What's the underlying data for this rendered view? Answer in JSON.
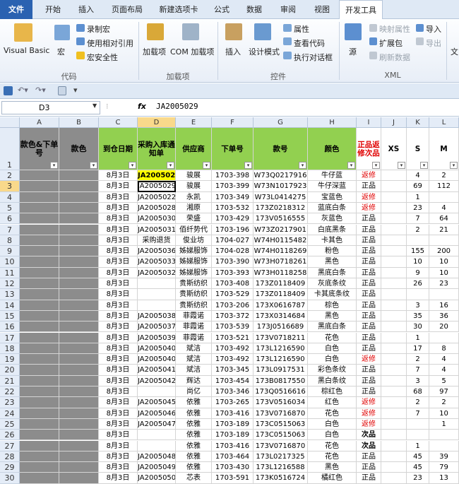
{
  "tabs": {
    "file": "文件",
    "home": "开始",
    "insert": "插入",
    "layout": "页面布局",
    "newtab": "新建选项卡",
    "formula": "公式",
    "data": "数据",
    "review": "审阅",
    "view": "视图",
    "dev": "开发工具"
  },
  "ribbon": {
    "vb": "Visual Basic",
    "macro": "宏",
    "rec": "录制宏",
    "relref": "使用相对引用",
    "sec": "宏安全性",
    "g_code": "代码",
    "addin": "加载项",
    "comaddin": "COM 加载项",
    "g_addin": "加载项",
    "insert": "插入",
    "design": "设计模式",
    "prop": "属性",
    "viewcode": "查看代码",
    "dialog": "执行对话框",
    "g_ctrl": "控件",
    "source": "源",
    "mapprop": "映射属性",
    "extpack": "扩展包",
    "refresh": "刷新数据",
    "imp": "导入",
    "exp": "导出",
    "g_xml": "XML",
    "doc": "文"
  },
  "namebox": "D3",
  "fx": "fx",
  "formula": "JA2005029",
  "cols": [
    "A",
    "B",
    "C",
    "D",
    "E",
    "F",
    "G",
    "H",
    "I",
    "J",
    "K",
    "L"
  ],
  "headers": [
    "款色&下单号",
    "款色",
    "到仓日期",
    "采购入库通知单",
    "供应商",
    "下单号",
    "款号",
    "颜色",
    "正品返修次品",
    "XS",
    "S",
    "M"
  ],
  "rows": [
    [
      "2",
      "8月3日",
      "JA2005025",
      "骏展",
      "1703-398",
      "W73Q0217916",
      "牛仔蓝",
      "返修",
      "",
      "4",
      "2"
    ],
    [
      "3",
      "8月3日",
      "JA2005029",
      "骏展",
      "1703-399",
      "W73N1017923",
      "牛仔深蓝",
      "正品",
      "",
      "69",
      "112"
    ],
    [
      "4",
      "8月3日",
      "JA2005022",
      "永凯",
      "1703-349",
      "W73L0414275",
      "宝蓝色",
      "返修",
      "",
      "1",
      ""
    ],
    [
      "5",
      "8月3日",
      "JA2005028",
      "湘原",
      "1703-532",
      "173Z0218312",
      "蓝底白条",
      "返修",
      "",
      "23",
      "4"
    ],
    [
      "6",
      "8月3日",
      "JA2005030",
      "荣盛",
      "1703-429",
      "173V0516555",
      "灰蓝色",
      "正品",
      "",
      "7",
      "64"
    ],
    [
      "7",
      "8月3日",
      "JA2005031",
      "佰纤势代",
      "1703-196",
      "W73Z0217901",
      "白底黑条",
      "正品",
      "",
      "2",
      "21"
    ],
    [
      "8",
      "8月3日",
      "采购退货",
      "俊业坊",
      "1704-027",
      "W74H0115482",
      "卡其色",
      "正品",
      "",
      "",
      ""
    ],
    [
      "9",
      "8月3日",
      "JA2005036",
      "姊娣服饰",
      "1704-028",
      "W74H0118269",
      "粉色",
      "正品",
      "",
      "155",
      "200"
    ],
    [
      "10",
      "8月3日",
      "JA2005033",
      "姊娣服饰",
      "1703-390",
      "W73H0718261",
      "黑色",
      "正品",
      "",
      "10",
      "10"
    ],
    [
      "11",
      "8月3日",
      "JA2005032",
      "姊娣服饰",
      "1703-393",
      "W73H0118258",
      "黑底白条",
      "正品",
      "",
      "9",
      "10"
    ],
    [
      "12",
      "8月3日",
      "",
      "贵斯纺织",
      "1703-408",
      "173Z0118409",
      "灰底条纹",
      "正品",
      "",
      "26",
      "23"
    ],
    [
      "13",
      "8月3日",
      "",
      "贵斯纺织",
      "1703-529",
      "173Z0118409",
      "卡其底条纹",
      "正品",
      "",
      "",
      ""
    ],
    [
      "14",
      "8月3日",
      "",
      "贵斯纺织",
      "1703-206",
      "173X0616787",
      "棕色",
      "正品",
      "",
      "3",
      "16"
    ],
    [
      "15",
      "8月3日",
      "JA2005038",
      "菲霞诺",
      "1703-372",
      "173X0314684",
      "黑色",
      "正品",
      "",
      "35",
      "36"
    ],
    [
      "16",
      "8月3日",
      "JA2005037",
      "菲霞诺",
      "1703-539",
      "173J0516689",
      "黑底白条",
      "正品",
      "",
      "30",
      "20"
    ],
    [
      "17",
      "8月3日",
      "JA2005039",
      "菲霞诺",
      "1703-521",
      "173V0718211",
      "花色",
      "正品",
      "",
      "1",
      ""
    ],
    [
      "18",
      "8月3日",
      "JA2005040",
      "斌洁",
      "1703-492",
      "173L1216590",
      "白色",
      "正品",
      "",
      "17",
      "8"
    ],
    [
      "19",
      "8月3日",
      "JA2005040",
      "斌洁",
      "1703-492",
      "173L1216590",
      "白色",
      "返修",
      "",
      "2",
      "4"
    ],
    [
      "20",
      "8月3日",
      "JA2005041",
      "斌洁",
      "1703-345",
      "173L0917531",
      "彩色条纹",
      "正品",
      "",
      "7",
      "4"
    ],
    [
      "21",
      "8月3日",
      "JA2005042",
      "辉达",
      "1703-454",
      "173B0817550",
      "黑白条纹",
      "正品",
      "",
      "3",
      "5"
    ],
    [
      "22",
      "8月3日",
      "",
      "尚亿",
      "1703-346",
      "173Q0516616",
      "棕红色",
      "正品",
      "",
      "68",
      "97"
    ],
    [
      "23",
      "8月3日",
      "JA2005045",
      "依雅",
      "1703-265",
      "173V0516034",
      "红色",
      "返修",
      "",
      "2",
      "2"
    ],
    [
      "24",
      "8月3日",
      "JA2005046",
      "依雅",
      "1703-416",
      "173V0716870",
      "花色",
      "返修",
      "",
      "7",
      "10"
    ],
    [
      "25",
      "8月3日",
      "JA2005047",
      "依雅",
      "1703-189",
      "173C0515063",
      "白色",
      "返修",
      "",
      "",
      "1"
    ],
    [
      "26",
      "8月3日",
      "",
      "依雅",
      "1703-189",
      "173C0515063",
      "白色",
      "次品",
      "",
      "",
      ""
    ],
    [
      "27",
      "8月3日",
      "",
      "依雅",
      "1703-416",
      "173V0716870",
      "花色",
      "次品",
      "",
      "1",
      ""
    ],
    [
      "28",
      "8月3日",
      "JA2005048",
      "依雅",
      "1703-464",
      "173L0217325",
      "花色",
      "正品",
      "",
      "45",
      "39"
    ],
    [
      "29",
      "8月3日",
      "JA2005049",
      "依雅",
      "1703-430",
      "173L1216588",
      "黑色",
      "正品",
      "",
      "45",
      "79"
    ],
    [
      "30",
      "8月3日",
      "JA2005050",
      "芯表",
      "1703-591",
      "173K0516724",
      "橘红色",
      "正品",
      "",
      "23",
      "13"
    ]
  ]
}
